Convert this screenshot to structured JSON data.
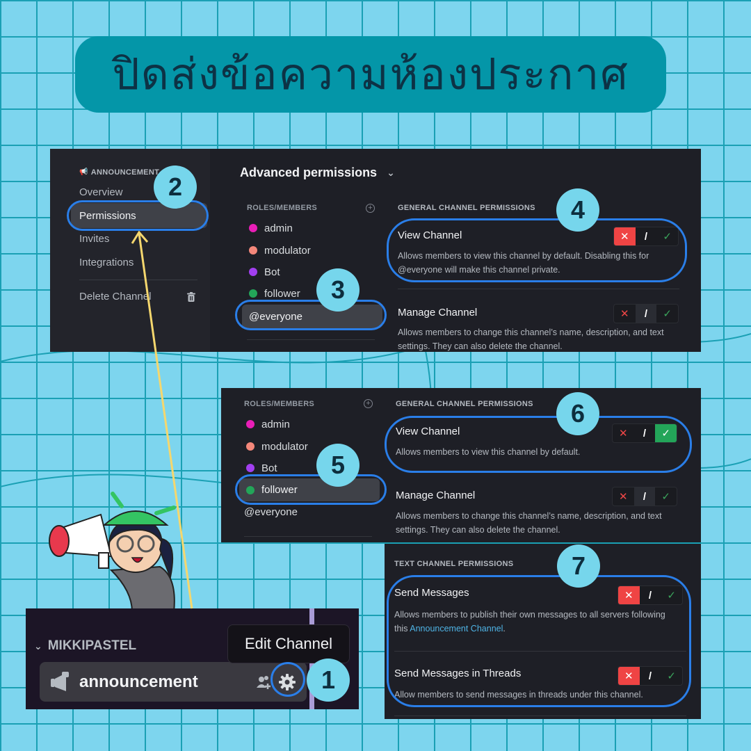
{
  "banner": {
    "title": "ปิดส่งข้อความห้องประกาศ"
  },
  "colors": {
    "background": "#7dd5ee",
    "grid": "#1aa0b4",
    "banner": "#0496a8",
    "panel": "#1e1f26",
    "highlight": "#2a7ee8",
    "badge": "#76d6ec",
    "deny": "#ef4444",
    "allow": "#23a559",
    "arrow": "#f5d76e"
  },
  "steps": [
    "1",
    "2",
    "3",
    "4",
    "5",
    "6",
    "7"
  ],
  "settings_sidebar": {
    "header": "ANNOUNCEMENT",
    "items": [
      {
        "label": "Overview",
        "active": false
      },
      {
        "label": "Permissions",
        "active": true
      },
      {
        "label": "Invites",
        "active": false
      },
      {
        "label": "Integrations",
        "active": false
      }
    ],
    "delete_label": "Delete Channel"
  },
  "advanced": {
    "title": "Advanced permissions",
    "roles_header": "ROLES/MEMBERS"
  },
  "roles_a": [
    {
      "name": "admin",
      "color": "#e91eb7"
    },
    {
      "name": "modulator",
      "color": "#f4877a"
    },
    {
      "name": "Bot",
      "color": "#a23ff0"
    },
    {
      "name": "follower",
      "color": "#23a559"
    },
    {
      "name": "@everyone",
      "color": null,
      "active": true
    }
  ],
  "roles_b": [
    {
      "name": "admin",
      "color": "#e91eb7"
    },
    {
      "name": "modulator",
      "color": "#f4877a"
    },
    {
      "name": "Bot",
      "color": "#a23ff0"
    },
    {
      "name": "follower",
      "color": "#23a559",
      "active": true
    },
    {
      "name": "@everyone",
      "color": null
    }
  ],
  "general_a": {
    "header": "GENERAL CHANNEL PERMISSIONS",
    "perms": [
      {
        "name": "View Channel",
        "desc": "Allows members to view this channel by default. Disabling this for @everyone will make this channel private.",
        "state": "deny"
      },
      {
        "name": "Manage Channel",
        "desc": "Allows members to change this channel’s name, description, and text settings. They can also delete the channel.",
        "state": "neutral"
      }
    ]
  },
  "general_b": {
    "header": "GENERAL CHANNEL PERMISSIONS",
    "perms": [
      {
        "name": "View Channel",
        "desc": "Allows members to view this channel by default.",
        "state": "allow"
      },
      {
        "name": "Manage Channel",
        "desc": "Allows members to change this channel’s name, description, and text settings. They can also delete the channel.",
        "state": "neutral"
      }
    ]
  },
  "text_perms": {
    "header": "TEXT CHANNEL PERMISSIONS",
    "perms": [
      {
        "name": "Send Messages",
        "desc_prefix": "Allows members to publish their own messages to all servers following this ",
        "desc_link": "Announcement Channel",
        "desc_suffix": ".",
        "state": "deny"
      },
      {
        "name": "Send Messages in Threads",
        "desc": "Allow members to send messages in threads under this channel.",
        "state": "deny"
      }
    ]
  },
  "toggle_glyphs": {
    "deny": "✕",
    "neutral": "/",
    "allow": "✓"
  },
  "channel_list": {
    "category": "MIKKIPASTEL",
    "channel_name": "announcement",
    "tooltip": "Edit Channel"
  }
}
